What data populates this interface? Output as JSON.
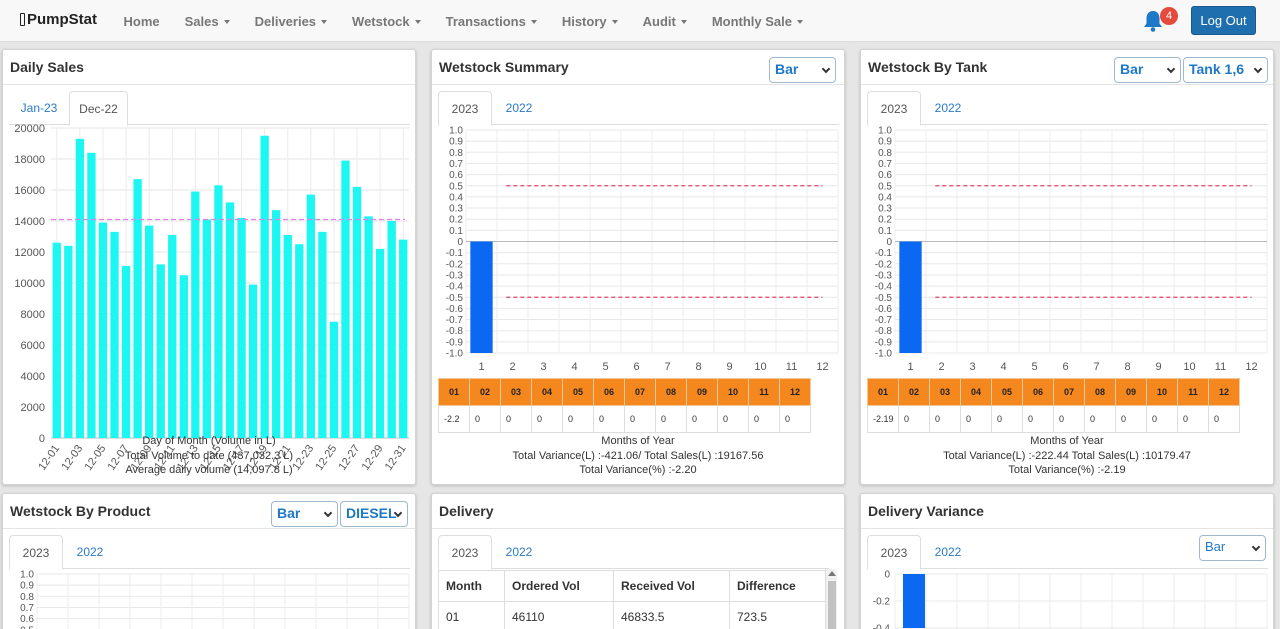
{
  "navbar": {
    "brand": "PumpStat",
    "menu": [
      {
        "label": "Home",
        "dropdown": false
      },
      {
        "label": "Sales",
        "dropdown": true
      },
      {
        "label": "Deliveries",
        "dropdown": true
      },
      {
        "label": "Wetstock",
        "dropdown": true
      },
      {
        "label": "Transactions",
        "dropdown": true
      },
      {
        "label": "History",
        "dropdown": true
      },
      {
        "label": "Audit",
        "dropdown": true
      },
      {
        "label": "Monthly Sale",
        "dropdown": true
      }
    ],
    "notification_count": "4",
    "logout_label": "Log Out"
  },
  "colors": {
    "accent": "#1f6fae",
    "daily_bar": "#1cf7f2",
    "avg_line": "#e27fe8",
    "variance_bar": "#0b68f0",
    "threshold_line": "#e0476a",
    "month_header": "#f5871f"
  },
  "daily_sales": {
    "title": "Daily Sales",
    "tabs": [
      "Jan-23",
      "Dec-22"
    ],
    "active_tab": "Dec-22",
    "caption": [
      "Day of Month (Volume in L)",
      "Total Volume to date (437,032.3 L)",
      "Average daily volume (14,097.8 L)"
    ]
  },
  "wetstock_summary": {
    "title": "Wetstock Summary",
    "chart_type": "Bar",
    "tabs": [
      "2023",
      "2022"
    ],
    "active_tab": "2023",
    "months": [
      "01",
      "02",
      "03",
      "04",
      "05",
      "06",
      "07",
      "08",
      "09",
      "10",
      "11",
      "12"
    ],
    "values": [
      "-2.2",
      "0",
      "0",
      "0",
      "0",
      "0",
      "0",
      "0",
      "0",
      "0",
      "0",
      "0"
    ],
    "caption": [
      "Months of Year",
      "Total Variance(L) :-421.06/ Total Sales(L) :19167.56",
      "Total Variance(%) :-2.20"
    ]
  },
  "wetstock_by_tank": {
    "title": "Wetstock By Tank",
    "chart_type": "Bar",
    "tank": "Tank 1,6",
    "tabs": [
      "2023",
      "2022"
    ],
    "active_tab": "2023",
    "months": [
      "01",
      "02",
      "03",
      "04",
      "05",
      "06",
      "07",
      "08",
      "09",
      "10",
      "11",
      "12"
    ],
    "values": [
      "-2.19",
      "0",
      "0",
      "0",
      "0",
      "0",
      "0",
      "0",
      "0",
      "0",
      "0",
      "0"
    ],
    "caption": [
      "Months of Year",
      "Total Variance(L) :-222.44 Total Sales(L) :10179.47",
      "Total Variance(%) :-2.19"
    ]
  },
  "wetstock_by_product": {
    "title": "Wetstock By Product",
    "chart_type": "Bar",
    "product": "DIESEL",
    "tabs": [
      "2023",
      "2022"
    ],
    "active_tab": "2023"
  },
  "delivery": {
    "title": "Delivery",
    "tabs": [
      "2023",
      "2022"
    ],
    "active_tab": "2023",
    "columns": [
      "Month",
      "Ordered Vol",
      "Received Vol",
      "Difference"
    ],
    "rows": [
      [
        "01",
        "46110",
        "46833.5",
        "723.5"
      ]
    ]
  },
  "delivery_variance": {
    "title": "Delivery Variance",
    "chart_type": "Bar",
    "tabs": [
      "2023",
      "2022"
    ],
    "active_tab": "2023"
  },
  "chart_data": [
    {
      "id": "daily_sales",
      "type": "bar",
      "categories": [
        "12-01",
        "12-02",
        "12-03",
        "12-04",
        "12-05",
        "12-06",
        "12-07",
        "12-08",
        "12-09",
        "12-10",
        "12-11",
        "12-12",
        "12-13",
        "12-14",
        "12-15",
        "12-16",
        "12-17",
        "12-18",
        "12-19",
        "12-20",
        "12-21",
        "12-22",
        "12-23",
        "12-24",
        "12-25",
        "12-26",
        "12-27",
        "12-28",
        "12-29",
        "12-30",
        "12-31"
      ],
      "tick_labels": [
        "12-01",
        "12-03",
        "12-05",
        "12-07",
        "12-09",
        "12-11",
        "12-13",
        "12-15",
        "12-17",
        "12-19",
        "12-21",
        "12-23",
        "12-25",
        "12-27",
        "12-29",
        "12-31"
      ],
      "values": [
        12600,
        12400,
        19300,
        18400,
        13900,
        13300,
        11100,
        16700,
        13700,
        11200,
        13100,
        10500,
        15900,
        14100,
        16300,
        15200,
        14200,
        9900,
        19500,
        14700,
        13100,
        12500,
        15700,
        13300,
        7500,
        17900,
        16200,
        14300,
        12200,
        14000,
        12800
      ],
      "average_line": 14097.8,
      "ylim": [
        0,
        20000
      ],
      "yticks": [
        0,
        2000,
        4000,
        6000,
        8000,
        10000,
        12000,
        14000,
        16000,
        18000,
        20000
      ],
      "xlabel": "Day of Month (Volume in L)"
    },
    {
      "id": "wetstock_summary",
      "type": "bar",
      "categories": [
        "1",
        "2",
        "3",
        "4",
        "5",
        "6",
        "7",
        "8",
        "9",
        "10",
        "11",
        "12"
      ],
      "values": [
        -1.0,
        0,
        0,
        0,
        0,
        0,
        0,
        0,
        0,
        0,
        0,
        0
      ],
      "threshold_lines": [
        0.5,
        -0.5
      ],
      "ylim": [
        -1.0,
        1.0
      ],
      "yticks": [
        "1.0",
        "0.9",
        "0.8",
        "0.7",
        "0.6",
        "0.5",
        "0.4",
        "0.3",
        "0.2",
        "0.1",
        "0",
        "-0.1",
        "-0.2",
        "-0.3",
        "-0.4",
        "-0.5",
        "-0.6",
        "-0.7",
        "-0.8",
        "-0.9",
        "-1.0"
      ],
      "xlabel": "Months of Year"
    },
    {
      "id": "wetstock_by_tank",
      "type": "bar",
      "categories": [
        "1",
        "2",
        "3",
        "4",
        "5",
        "6",
        "7",
        "8",
        "9",
        "10",
        "11",
        "12"
      ],
      "values": [
        -1.0,
        0,
        0,
        0,
        0,
        0,
        0,
        0,
        0,
        0,
        0,
        0
      ],
      "threshold_lines": [
        0.5,
        -0.5
      ],
      "ylim": [
        -1.0,
        1.0
      ],
      "yticks": [
        "1.0",
        "0.9",
        "0.8",
        "0.7",
        "0.6",
        "0.5",
        "0.4",
        "0.3",
        "0.2",
        "0.1",
        "0",
        "-0.1",
        "-0.2",
        "-0.3",
        "-0.4",
        "-0.5",
        "-0.6",
        "-0.7",
        "-0.8",
        "-0.9",
        "-1.0"
      ],
      "xlabel": "Months of Year"
    },
    {
      "id": "wetstock_by_product",
      "type": "bar",
      "yticks": [
        "1.0",
        "0.9",
        "0.8",
        "0.7",
        "0.6",
        "0.5"
      ],
      "ylim": [
        -1.0,
        1.0
      ]
    },
    {
      "id": "delivery_variance",
      "type": "bar",
      "yticks": [
        "0",
        "-0.2",
        "-0.4"
      ],
      "values": [
        -0.4
      ]
    }
  ]
}
